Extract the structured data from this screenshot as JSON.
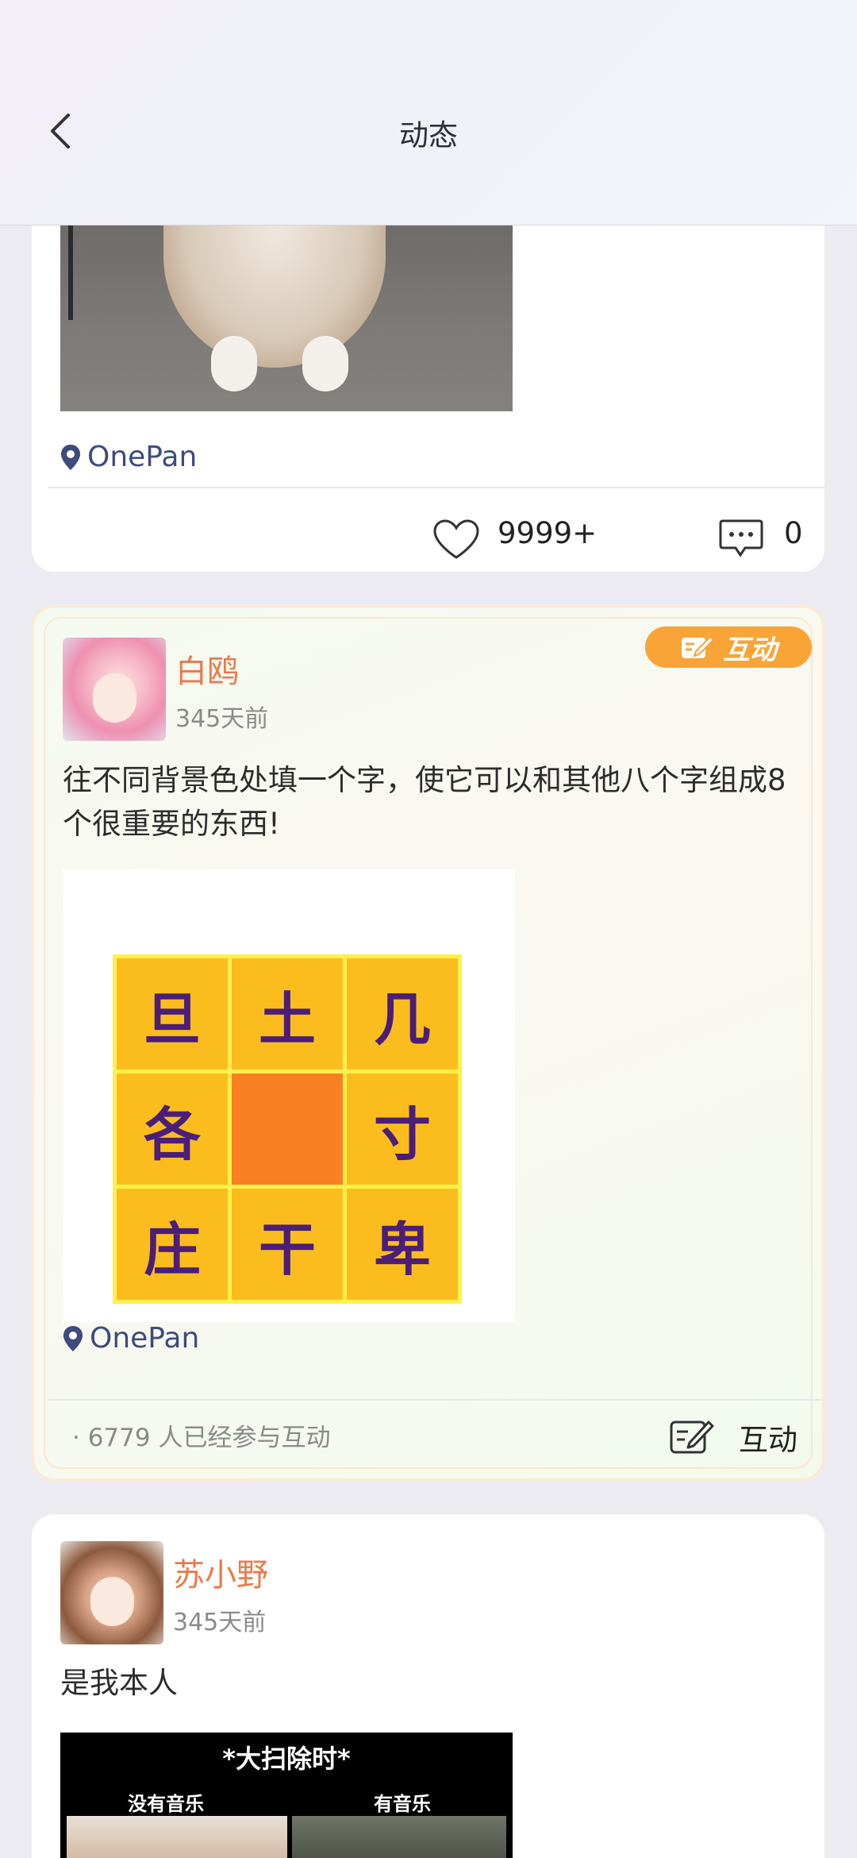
{
  "header": {
    "title": "动态"
  },
  "post1": {
    "location": "OnePan",
    "likes": "9999+",
    "comments": "0"
  },
  "post2": {
    "username": "白鸥",
    "time": "345天前",
    "badge": "互动",
    "text": "往不同背景色处填一个字，使它可以和其他八个字组成8个很重要的东西!",
    "puzzle": [
      "旦",
      "土",
      "几",
      "各",
      "",
      "寸",
      "庄",
      "干",
      "卑"
    ],
    "location": "OnePan",
    "participants": "· 6779  人已经参与互动",
    "action_label": "互动"
  },
  "post3": {
    "username": "苏小野",
    "time": "345天前",
    "text": "是我本人",
    "image_title": "*大扫除时*",
    "image_left_label": "没有音乐",
    "image_right_label": "有音乐"
  },
  "colors": {
    "username": "#ea7b4c",
    "badge": "#f8a437",
    "location": "#3e4b7c",
    "puzzle_cell": "#fbbd1e",
    "puzzle_center": "#f98022",
    "puzzle_text": "#4b1e79"
  }
}
